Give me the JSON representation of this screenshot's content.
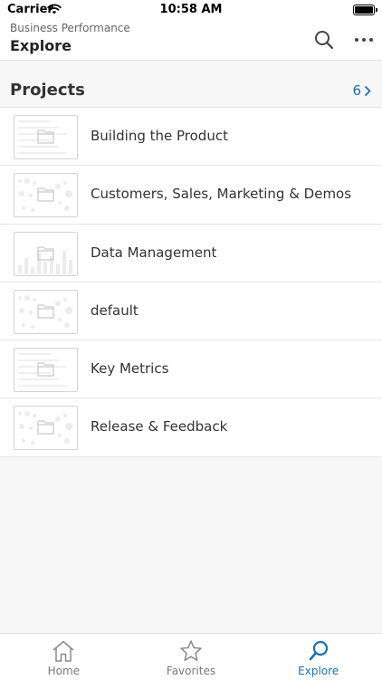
{
  "status": {
    "carrier": "Carrier",
    "time": "10:58 AM"
  },
  "header": {
    "subtitle": "Business Performance",
    "title": "Explore"
  },
  "section": {
    "title": "Projects",
    "count": "6"
  },
  "projects": [
    {
      "name": "Building the Product",
      "thumb": "lines"
    },
    {
      "name": "Customers, Sales, Marketing & Demos",
      "thumb": "dots"
    },
    {
      "name": "Data Management",
      "thumb": "bars"
    },
    {
      "name": "default",
      "thumb": "dots"
    },
    {
      "name": "Key Metrics",
      "thumb": "lines"
    },
    {
      "name": "Release & Feedback",
      "thumb": "dots"
    }
  ],
  "tabs": [
    {
      "label": "Home",
      "icon": "home-icon",
      "active": false
    },
    {
      "label": "Favorites",
      "icon": "star-icon",
      "active": false
    },
    {
      "label": "Explore",
      "icon": "explore-search-icon",
      "active": true
    }
  ],
  "colors": {
    "accent": "#1f6fa8",
    "text": "#333333",
    "background": "#f7f7f7"
  }
}
